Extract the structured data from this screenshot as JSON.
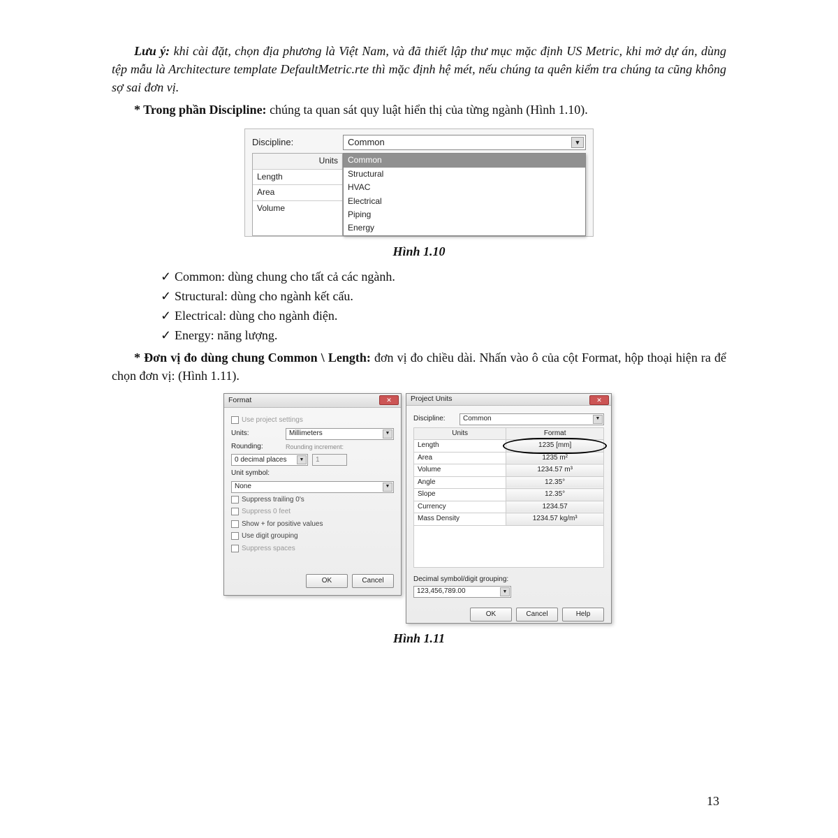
{
  "note": {
    "label": "Lưu ý:",
    "text": " khi cài đặt, chọn địa phương là Việt Nam, và đã thiết lập thư mục mặc định US Metric, khi mở dự án, dùng tệp mẫu là Architecture template DefaultMetric.rte thì mặc định hệ mét, nếu chúng ta quên kiểm tra chúng ta cũng không sợ sai đơn vị."
  },
  "discipline_para": {
    "lead": "* Trong phần Discipline:",
    "rest": " chúng ta quan sát quy luật hiển thị của từng ngành (Hình 1.10)."
  },
  "fig110": {
    "discipline_label": "Discipline:",
    "combo_value": "Common",
    "units_header": "Units",
    "left_rows": [
      "Length",
      "Area",
      "Volume"
    ],
    "options": [
      "Common",
      "Structural",
      "HVAC",
      "Electrical",
      "Piping",
      "Energy"
    ],
    "caption": "Hình 1.10"
  },
  "checks": [
    "Common: dùng chung cho tất cả các ngành.",
    "Structural: dùng cho ngành kết cấu.",
    "Electrical: dùng cho ngành điện.",
    "Energy: năng lượng."
  ],
  "length_para": {
    "lead": "* Đơn vị đo dùng chung Common \\ Length:",
    "rest": " đơn vị đo chiều dài. Nhấn vào ô của cột Format, hộp thoại hiện ra để chọn đơn vị: (Hình 1.11)."
  },
  "fig111": {
    "caption": "Hình 1.11",
    "format_dlg": {
      "title": "Format",
      "use_project": "Use project settings",
      "units_label": "Units:",
      "units_value": "Millimeters",
      "rounding_label": "Rounding:",
      "rounding_value": "0 decimal places",
      "rounding_incr_label": "Rounding increment:",
      "rounding_incr_value": "1",
      "unit_symbol_label": "Unit symbol:",
      "unit_symbol_value": "None",
      "opts": [
        {
          "t": "Suppress trailing 0's",
          "d": false
        },
        {
          "t": "Suppress 0 feet",
          "d": true
        },
        {
          "t": "Show + for positive values",
          "d": false
        },
        {
          "t": "Use digit grouping",
          "d": false
        },
        {
          "t": "Suppress spaces",
          "d": true
        }
      ],
      "ok": "OK",
      "cancel": "Cancel"
    },
    "pu_dlg": {
      "title": "Project Units",
      "discipline_label": "Discipline:",
      "discipline_value": "Common",
      "cols": [
        "Units",
        "Format"
      ],
      "rows": [
        {
          "u": "Length",
          "f": "1235 [mm]",
          "hl": true
        },
        {
          "u": "Area",
          "f": "1235 m²"
        },
        {
          "u": "Volume",
          "f": "1234.57 m³"
        },
        {
          "u": "Angle",
          "f": "12.35°"
        },
        {
          "u": "Slope",
          "f": "12.35°"
        },
        {
          "u": "Currency",
          "f": "1234.57"
        },
        {
          "u": "Mass Density",
          "f": "1234.57 kg/m³"
        }
      ],
      "decimal_label": "Decimal symbol/digit grouping:",
      "decimal_value": "123,456,789.00",
      "ok": "OK",
      "cancel": "Cancel",
      "help": "Help"
    }
  },
  "page_number": "13"
}
